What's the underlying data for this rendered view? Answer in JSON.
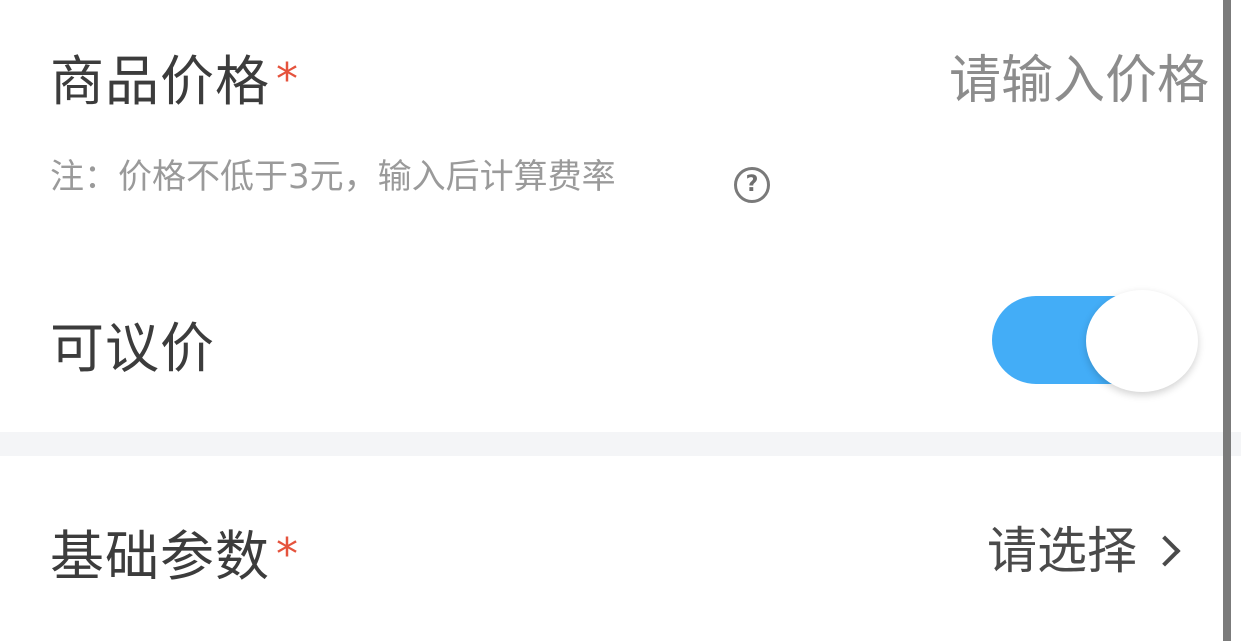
{
  "price_row": {
    "label": "商品价格",
    "required_mark": "*",
    "input_placeholder": "请输入价格",
    "input_value": "",
    "note": "注：价格不低于3元，输入后计算费率",
    "help_icon": "question-circle-icon"
  },
  "negotiable_row": {
    "label": "可议价",
    "toggle_on": true,
    "toggle_color": "#43adf7"
  },
  "params_row": {
    "label": "基础参数",
    "required_mark": "*",
    "select_placeholder": "请选择",
    "chevron_icon": "chevron-right-icon"
  },
  "colors": {
    "required": "#e5533d",
    "placeholder": "#8c8c8c",
    "note": "#9a9a9a",
    "divider": "#f4f5f7"
  }
}
